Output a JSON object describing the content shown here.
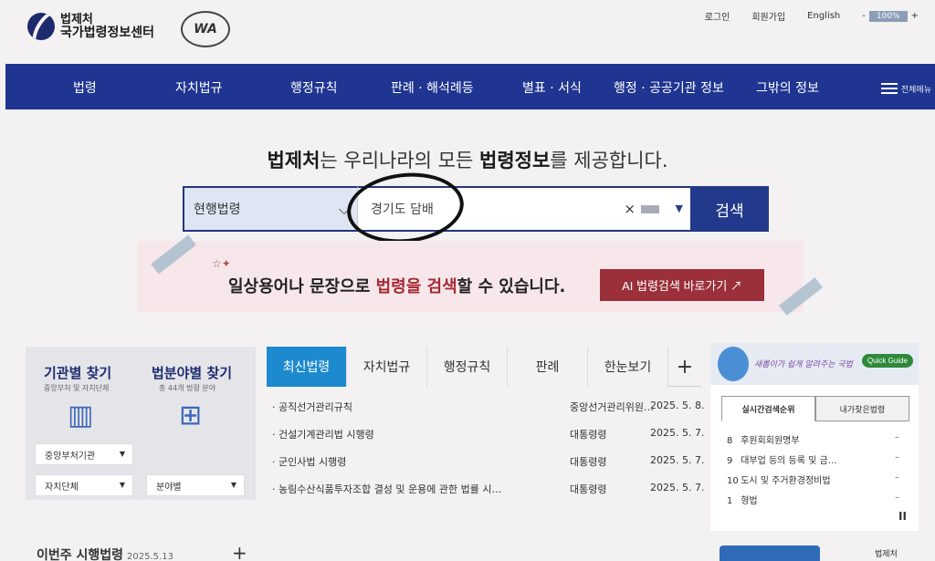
{
  "header": {
    "logo_line1": "법제처",
    "logo_line2": "국가법령정보센터",
    "badge": "WA",
    "links": [
      "로그인",
      "회원가입",
      "English"
    ],
    "zoom_minus": "-",
    "zoom_value": "100%",
    "zoom_plus": "+"
  },
  "nav": {
    "items": [
      "법령",
      "자치법규",
      "행정규칙",
      "판례 · 해석례등",
      "별표 · 서식",
      "행정 · 공공기관 정보",
      "그밖의 정보"
    ],
    "all_menu": "전체메뉴"
  },
  "tagline": {
    "p1": "법제처",
    "p2": "는 우리나라의 모든 ",
    "p3": "법령정보",
    "p4": "를 제공합니다."
  },
  "search": {
    "scope": "현행법령",
    "query": "경기도 담배",
    "clear": "×",
    "button": "검색"
  },
  "ai": {
    "p1": "일상용어나 문장으로 ",
    "p2": "법령을 검색",
    "p3": "할 수 있습니다.",
    "button": "AI 법령검색 바로가기 ↗"
  },
  "left": {
    "org_title": "기관별 찾기",
    "org_sub": "중앙부처 및 자치단체",
    "field_title": "법분야별 찾기",
    "field_sub": "총 44개 법령 분야",
    "select1": "중앙부처기관",
    "select2": "자치단체",
    "select3": "분야별",
    "this_week": "이번주 시행법령",
    "this_week_date": "2025.5.13",
    "plus": "+"
  },
  "tabs": {
    "items": [
      "최신법령",
      "자치법규",
      "행정규칙",
      "판례",
      "한눈보기"
    ],
    "plus": "+"
  },
  "laws": [
    {
      "title": "· 공직선거관리규칙",
      "agency": "중앙선거관리위원…",
      "date": "2025. 5. 8."
    },
    {
      "title": "· 건설기계관리법 시행령",
      "agency": "대통령령",
      "date": "2025. 5. 7."
    },
    {
      "title": "· 군인사법 시행령",
      "agency": "대통령령",
      "date": "2025. 5. 7."
    },
    {
      "title": "· 농림수산식품투자조합 결성 및 운용에 관한 법률 시…",
      "agency": "대통령령",
      "date": "2025. 5. 7."
    }
  ],
  "right": {
    "banner_text": "새롭이가 쉽게 알려주는 국법",
    "quick_guide": "Quick Guide",
    "tab1": "실시간검색순위",
    "tab2": "내가찾은법령",
    "ranks": [
      {
        "n": "8",
        "t": "후원회회원명부"
      },
      {
        "n": "9",
        "t": "대부업 등의 등록 및 금…"
      },
      {
        "n": "10",
        "t": "도시 및 주거환경정비법"
      },
      {
        "n": "1",
        "t": "형법"
      }
    ],
    "dash": "–",
    "pause": "II"
  },
  "footer": {
    "logo": "법제처"
  }
}
